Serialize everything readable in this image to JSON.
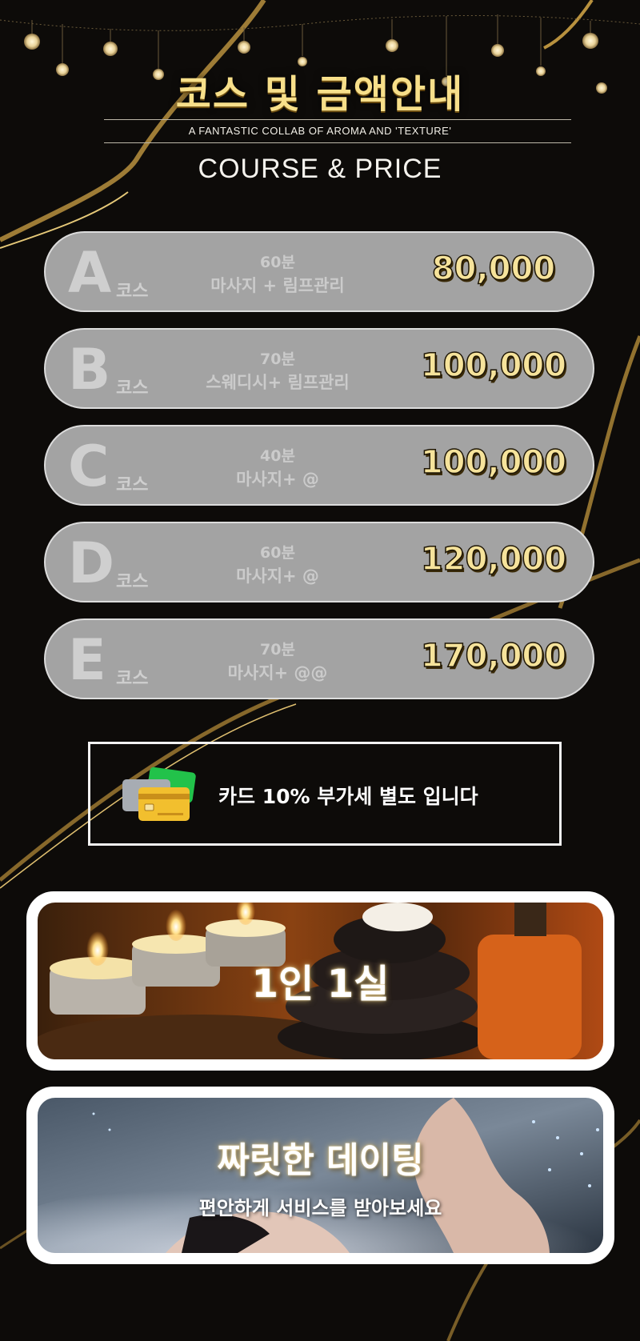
{
  "header": {
    "title_ko": "코스 및 금액안내",
    "tagline": "A FANTASTIC COLLAB OF AROMA AND 'TEXTURE'",
    "title_en": "COURSE & PRICE"
  },
  "courses": [
    {
      "letter": "A",
      "suffix": "코스",
      "duration": "60분",
      "desc": "마사지 + 림프관리",
      "price": "80,000"
    },
    {
      "letter": "B",
      "suffix": "코스",
      "duration": "70분",
      "desc": "스웨디시+ 림프관리",
      "price": "100,000"
    },
    {
      "letter": "C",
      "suffix": "코스",
      "duration": "40분",
      "desc": "마사지+ @",
      "price": "100,000"
    },
    {
      "letter": "D",
      "suffix": "코스",
      "duration": "60분",
      "desc": "마사지+ @",
      "price": "120,000"
    },
    {
      "letter": "E",
      "suffix": "코스",
      "duration": "70분",
      "desc": "마사지+ @@",
      "price": "170,000"
    }
  ],
  "notice": {
    "text": "카드 10% 부가세 별도 입니다",
    "icon": "credit-card-icon"
  },
  "panels": {
    "room": {
      "title": "1인 1실"
    },
    "dating": {
      "title": "짜릿한 데이팅",
      "subtitle": "편안하게 서비스를 받아보세요"
    }
  },
  "colors": {
    "background": "#0d0b09",
    "gold": "#c9a24a",
    "course_bg": "#a3a3a3",
    "price": "#f6e39b"
  }
}
